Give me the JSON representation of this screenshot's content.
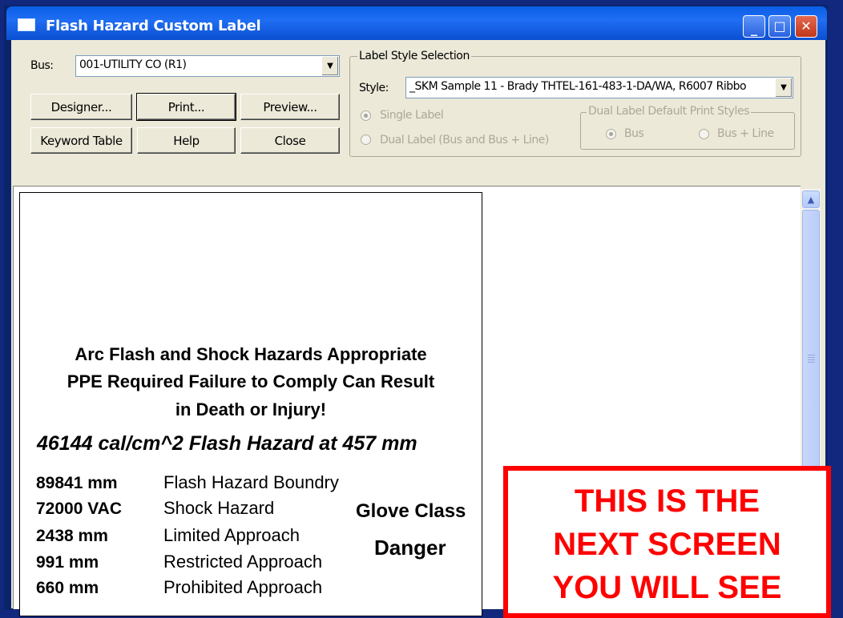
{
  "window": {
    "title": "Flash Hazard Custom Label",
    "controls": {
      "minimize": "_",
      "maximize": "□",
      "close": "✕"
    }
  },
  "bus": {
    "label": "Bus:",
    "value": "001-UTILITY CO  (R1)"
  },
  "buttons": {
    "designer": "Designer...",
    "print": "Print...",
    "preview": "Preview...",
    "keyword_table": "Keyword Table",
    "help": "Help",
    "close": "Close"
  },
  "label_style": {
    "group_title": "Label Style Selection",
    "style_label": "Style:",
    "style_value": "_SKM Sample 11 - Brady THTEL-161-483-1-DA/WA, R6007 Ribbo",
    "single_label": "Single Label",
    "dual_label": "Dual Label (Bus and Bus + Line)",
    "dual_group_title": "Dual Label Default Print Styles",
    "bus_option": "Bus",
    "bus_line_option": "Bus + Line"
  },
  "hazard_label": {
    "warning_lines": [
      "Arc Flash and Shock Hazards Appropriate",
      "PPE Required Failure to Comply Can Result",
      "in Death or Injury!"
    ],
    "flash_line": "46144 cal/cm^2  Flash Hazard at 457 mm",
    "rows": [
      {
        "value": "89841 mm",
        "desc": "Flash Hazard Boundry"
      },
      {
        "value": "72000 VAC",
        "desc": "Shock Hazard"
      },
      {
        "value": "2438 mm",
        "desc": "Limited Approach"
      },
      {
        "value": "991 mm",
        "desc": "Restricted Approach"
      },
      {
        "value": "660 mm",
        "desc": "Prohibited Approach"
      }
    ],
    "glove_class": "Glove Class",
    "danger": "Danger"
  },
  "callout": {
    "lines": [
      "THIS IS THE",
      "NEXT SCREEN",
      "YOU WILL SEE"
    ],
    "color": "#ff0000"
  },
  "colors": {
    "titlebar": "#0a5ee6",
    "dialog_bg": "#ece9d8",
    "disabled_text": "#aca899"
  }
}
